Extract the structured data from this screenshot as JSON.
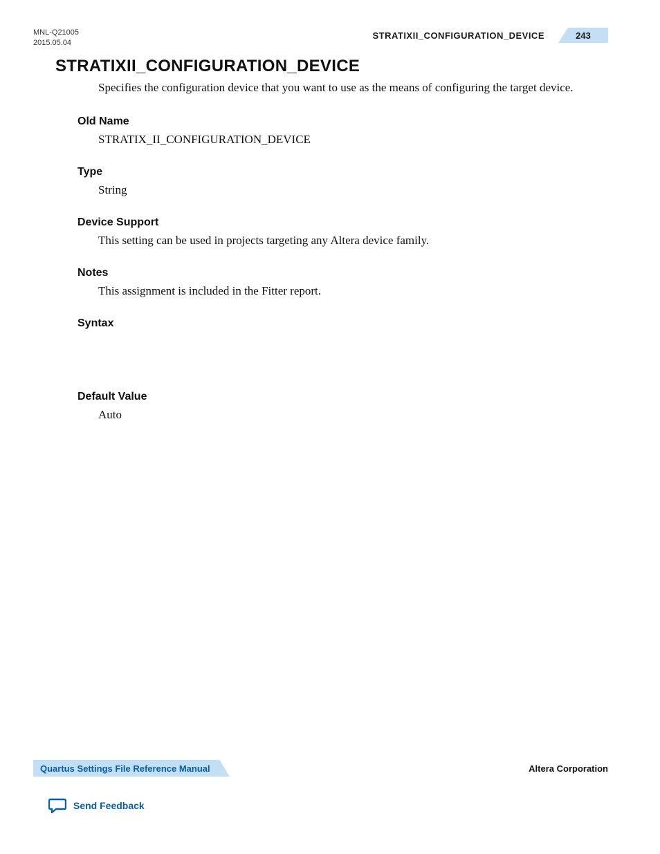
{
  "header": {
    "doc_id": "MNL-Q21005",
    "date": "2015.05.04",
    "running_title": "STRATIXII_CONFIGURATION_DEVICE",
    "page_number": "243"
  },
  "title": "STRATIXII_CONFIGURATION_DEVICE",
  "intro": "Specifies the configuration device that you want to use as the means of configuring the target device.",
  "sections": {
    "old_name": {
      "head": "Old Name",
      "body": "STRATIX_II_CONFIGURATION_DEVICE"
    },
    "type": {
      "head": "Type",
      "body": "String"
    },
    "device_support": {
      "head": "Device Support",
      "body": "This setting can be used in projects targeting any Altera device family."
    },
    "notes": {
      "head": "Notes",
      "body": "This assignment is included in the Fitter report."
    },
    "syntax": {
      "head": "Syntax"
    },
    "default_value": {
      "head": "Default Value",
      "body": "Auto"
    }
  },
  "footer": {
    "manual_link": "Quartus Settings File Reference Manual",
    "company": "Altera Corporation",
    "feedback": "Send Feedback"
  }
}
